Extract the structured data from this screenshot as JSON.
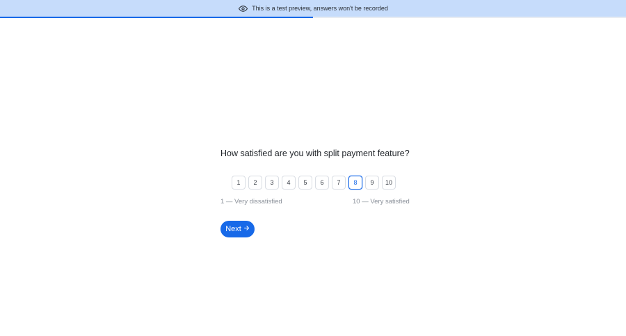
{
  "banner": {
    "icon": "eye-icon",
    "text": "This is a test preview, answers won't be recorded"
  },
  "progress": {
    "fraction": 0.5,
    "color": "#1769e8"
  },
  "question": {
    "text": "How satisfied are you with split payment feature?"
  },
  "scale": {
    "options": [
      "1",
      "2",
      "3",
      "4",
      "5",
      "6",
      "7",
      "8",
      "9",
      "10"
    ],
    "selected": "8",
    "min_label": "1 — Very dissatisfied",
    "max_label": "10 — Very satisfied"
  },
  "actions": {
    "next_label": "Next",
    "next_icon": "arrow-right-icon"
  },
  "colors": {
    "accent": "#1769e8",
    "banner_bg": "#c6dcfb"
  }
}
